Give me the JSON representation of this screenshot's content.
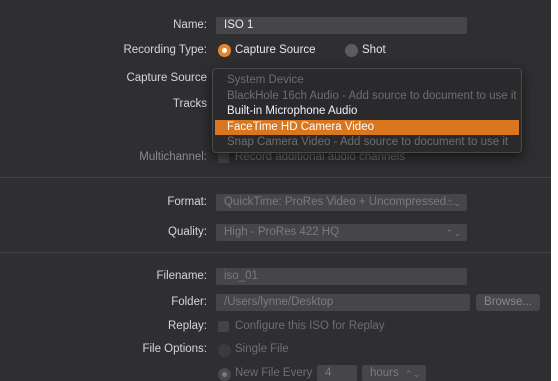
{
  "name": {
    "label": "Name:",
    "value": "ISO 1"
  },
  "recording_type": {
    "label": "Recording Type:",
    "options": [
      "Capture Source",
      "Shot"
    ],
    "selected": "Capture Source"
  },
  "capture_source": {
    "label": "Capture Source"
  },
  "tracks": {
    "label": "Tracks"
  },
  "dropdown": {
    "items": [
      {
        "label": "System Device",
        "state": "disabled"
      },
      {
        "label": "BlackHole 16ch Audio - Add source to document to use it",
        "state": "disabled"
      },
      {
        "label": "Built-in Microphone Audio",
        "state": "enabled"
      },
      {
        "label": "FaceTime HD Camera Video",
        "state": "selected"
      },
      {
        "label": "Snap Camera Video - Add source to document to use it",
        "state": "disabled"
      }
    ]
  },
  "multichannel": {
    "label": "Multichannel:",
    "checkbox_label": "Record additional audio channels"
  },
  "format": {
    "label": "Format:",
    "value": "QuickTime: ProRes Video + Uncompressed..."
  },
  "quality": {
    "label": "Quality:",
    "value": "High - ProRes 422 HQ"
  },
  "filename": {
    "label": "Filename:",
    "value": "iso_01"
  },
  "folder": {
    "label": "Folder:",
    "value": "/Users/lynne/Desktop",
    "browse_label": "Browse..."
  },
  "replay": {
    "label": "Replay:",
    "checkbox_label": "Configure this ISO for Replay"
  },
  "file_options": {
    "label": "File Options:",
    "single_file": "Single File",
    "new_file_every": "New File Every",
    "interval_value": "4",
    "interval_unit": "hours"
  },
  "colors": {
    "panel_bg": "#2f2f31",
    "accent": "#e3872a",
    "menu_selected": "#d9771f"
  }
}
